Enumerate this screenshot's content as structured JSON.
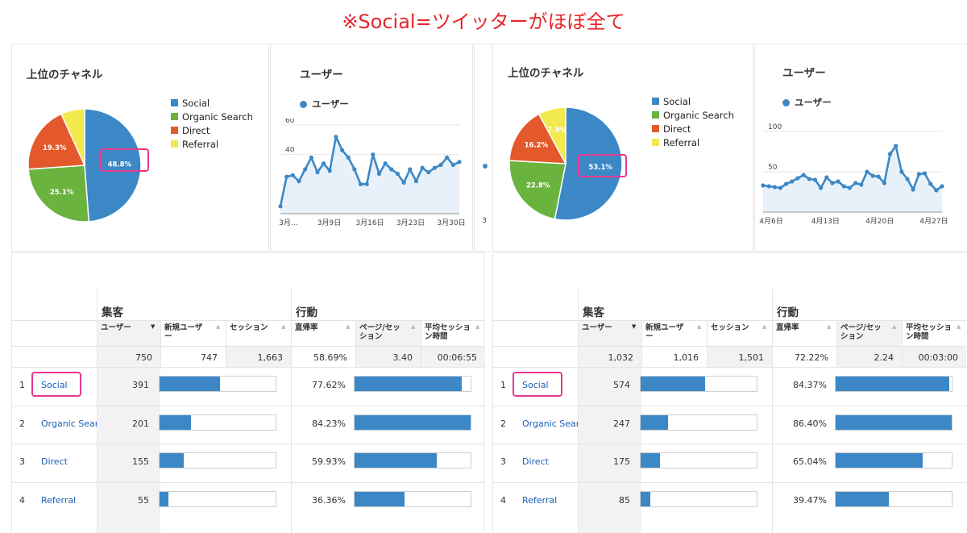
{
  "banner": "※Social=ツイッターがほぼ全て",
  "panels": [
    {
      "channels_title": "上位のチャネル",
      "users_title": "ユーザー",
      "series_label": "ユーザー",
      "chart_data": {
        "type": "line",
        "series": [
          {
            "name": "ユーザー",
            "values": [
              5,
              25,
              26,
              22,
              30,
              38,
              28,
              34,
              29,
              52,
              43,
              38,
              30,
              20,
              20,
              40,
              27,
              34,
              30,
              27,
              21,
              30,
              22,
              31,
              28,
              31,
              33,
              38,
              33,
              35
            ]
          }
        ],
        "ylim": [
          0,
          60
        ],
        "y_ticks": [
          "20",
          "40",
          "60"
        ],
        "x_ticks": [
          "3月…",
          "3月9日",
          "3月16日",
          "3月23日",
          "3月30日"
        ]
      },
      "pie": {
        "type": "pie",
        "slices": [
          {
            "name": "Social",
            "value": 48.8,
            "label": "48.8%",
            "color": "#3c88c6"
          },
          {
            "name": "Organic Search",
            "value": 25.1,
            "label": "25.1%",
            "color": "#6bb33f"
          },
          {
            "name": "Direct",
            "value": 19.3,
            "label": "19.3%",
            "color": "#e3592b"
          },
          {
            "name": "Referral",
            "value": 6.8,
            "label": "",
            "color": "#f2e94e"
          }
        ]
      },
      "table": {
        "group_acq": "集客",
        "group_beh": "行動",
        "headers": {
          "users": "ユーザー",
          "new_users_1": "新規ユーザ",
          "new_users_2": "ー",
          "sessions": "セッション",
          "bounce": "直帰率",
          "pps_1": "ページ/セッ",
          "pps_2": "ション",
          "dur_1": "平均セッショ",
          "dur_2": "ン時間"
        },
        "totals": {
          "users": "750",
          "new_users": "747",
          "sessions": "1,663",
          "bounce": "58.69%",
          "pps": "3.40",
          "dur": "00:06:55"
        },
        "rows": [
          {
            "rank": "1",
            "name": "Social",
            "users": "391",
            "users_frac": 0.5213,
            "bounce": "77.62%",
            "bounce_frac": 0.9216
          },
          {
            "rank": "2",
            "name": "Organic Search",
            "users": "201",
            "users_frac": 0.268,
            "bounce": "84.23%",
            "bounce_frac": 1.0
          },
          {
            "rank": "3",
            "name": "Direct",
            "users": "155",
            "users_frac": 0.2067,
            "bounce": "59.93%",
            "bounce_frac": 0.7115
          },
          {
            "rank": "4",
            "name": "Referral",
            "users": "55",
            "users_frac": 0.0733,
            "bounce": "36.36%",
            "bounce_frac": 0.4317
          }
        ]
      }
    },
    {
      "channels_title": "上位のチャネル",
      "users_title": "ユーザー",
      "series_label": "ユーザー",
      "chart_data": {
        "type": "line",
        "series": [
          {
            "name": "ユーザー",
            "values": [
              33,
              32,
              31,
              30,
              35,
              38,
              42,
              46,
              41,
              40,
              30,
              43,
              36,
              38,
              32,
              30,
              36,
              34,
              50,
              45,
              44,
              36,
              72,
              82,
              50,
              41,
              28,
              47,
              48,
              35,
              27,
              32
            ]
          }
        ],
        "ylim": [
          0,
          110
        ],
        "y_ticks": [
          "50",
          "100"
        ],
        "x_ticks": [
          "4月6日",
          "4月13日",
          "4月20日",
          "4月27日"
        ]
      },
      "pie": {
        "type": "pie",
        "slices": [
          {
            "name": "Social",
            "value": 53.1,
            "label": "53.1%",
            "color": "#3c88c6"
          },
          {
            "name": "Organic Search",
            "value": 22.8,
            "label": "22.8%",
            "color": "#6bb33f"
          },
          {
            "name": "Direct",
            "value": 16.2,
            "label": "16.2%",
            "color": "#e3592b"
          },
          {
            "name": "Referral",
            "value": 7.9,
            "label": "7.9%",
            "color": "#f2e94e"
          }
        ]
      },
      "table": {
        "group_acq": "集客",
        "group_beh": "行動",
        "headers": {
          "users": "ユーザー",
          "new_users_1": "新規ユーザ",
          "new_users_2": "ー",
          "sessions": "セッション",
          "bounce": "直帰率",
          "pps_1": "ページ/セッ",
          "pps_2": "ション",
          "dur_1": "平均セッショ",
          "dur_2": "ン時間"
        },
        "totals": {
          "users": "1,032",
          "new_users": "1,016",
          "sessions": "1,501",
          "bounce": "72.22%",
          "pps": "2.24",
          "dur": "00:03:00"
        },
        "rows": [
          {
            "rank": "1",
            "name": "Social",
            "users": "574",
            "users_frac": 0.5562,
            "bounce": "84.37%",
            "bounce_frac": 0.9765
          },
          {
            "rank": "2",
            "name": "Organic Search",
            "users": "247",
            "users_frac": 0.2393,
            "bounce": "86.40%",
            "bounce_frac": 1.0
          },
          {
            "rank": "3",
            "name": "Direct",
            "users": "175",
            "users_frac": 0.1696,
            "bounce": "65.04%",
            "bounce_frac": 0.7528
          },
          {
            "rank": "4",
            "name": "Referral",
            "users": "85",
            "users_frac": 0.0824,
            "bounce": "39.47%",
            "bounce_frac": 0.4568
          }
        ]
      }
    }
  ]
}
